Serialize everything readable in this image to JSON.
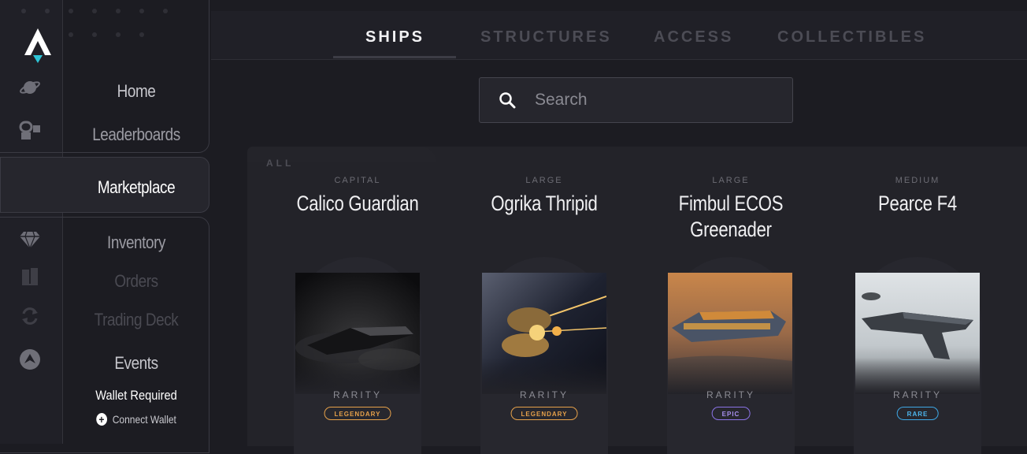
{
  "sidebar": {
    "nav_items": [
      {
        "label": "Home"
      },
      {
        "label": "Leaderboards"
      },
      {
        "label": "Marketplace"
      },
      {
        "label": "Inventory"
      },
      {
        "label": "Orders"
      },
      {
        "label": "Trading Deck"
      },
      {
        "label": "Events"
      }
    ],
    "wallet_required": "Wallet Required",
    "connect_wallet": "Connect Wallet",
    "rail_icons": [
      "planet-icon",
      "crew-icon",
      "cart-icon",
      "diamond-icon",
      "book-icon",
      "swap-icon",
      "faction-icon"
    ]
  },
  "tabs": [
    {
      "label": "SHIPS"
    },
    {
      "label": "STRUCTURES"
    },
    {
      "label": "ACCESS"
    },
    {
      "label": "COLLECTIBLES"
    }
  ],
  "search": {
    "placeholder": "Search"
  },
  "section_label": "ALL",
  "cards": [
    {
      "size": "CAPITAL",
      "name": "Calico Guardian",
      "rarity_label": "RARITY",
      "rarity": "LEGENDARY"
    },
    {
      "size": "LARGE",
      "name": "Ogrika Thripid",
      "rarity_label": "RARITY",
      "rarity": "LEGENDARY"
    },
    {
      "size": "LARGE",
      "name": "Fimbul ECOS Greenader",
      "rarity_label": "RARITY",
      "rarity": "EPIC"
    },
    {
      "size": "MEDIUM",
      "name": "Pearce F4",
      "rarity_label": "RARITY",
      "rarity": "RARE"
    }
  ],
  "colors": {
    "background": "#1c1c22",
    "legendary": "#e6a14a",
    "epic": "#8b73e6",
    "rare": "#3ea8e6",
    "logo_accent": "#2ec4d6"
  }
}
